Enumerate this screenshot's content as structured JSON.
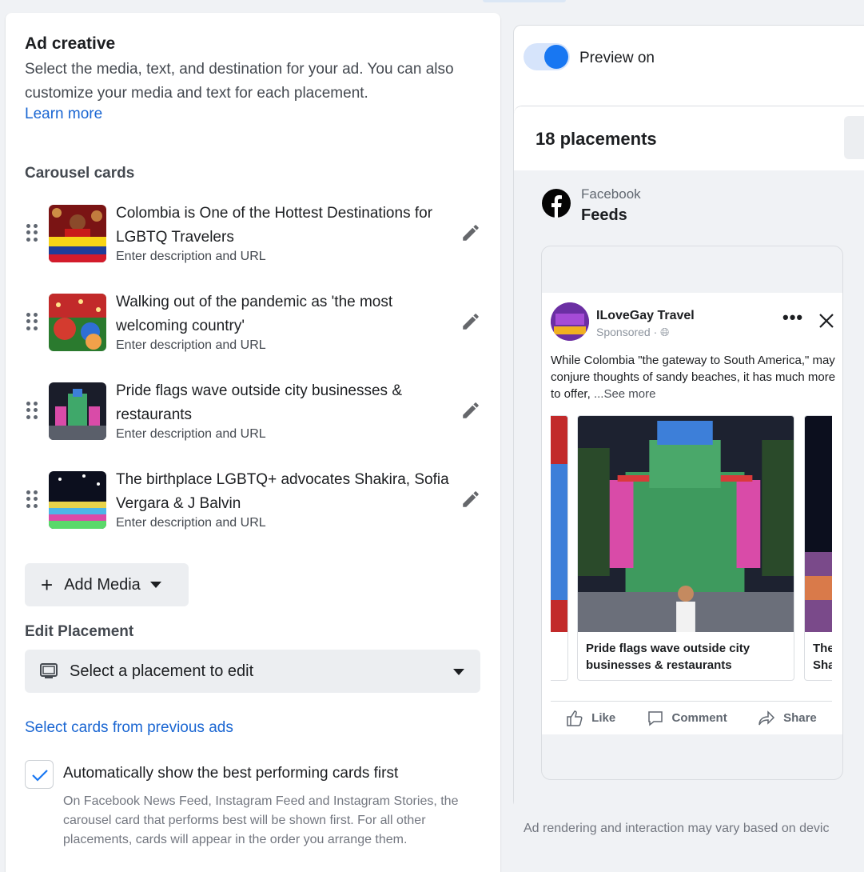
{
  "ad_creative": {
    "title": "Ad creative",
    "description": "Select the media, text, and destination for your ad. You can also customize your media and text for each placement.",
    "learn_more": "Learn more"
  },
  "carousel": {
    "heading": "Carousel cards",
    "cards": [
      {
        "title": "Colombia is One of the Hottest Destinations for LGBTQ Travelers",
        "subtitle": "Enter description and URL"
      },
      {
        "title": "Walking out of the pandemic as 'the most welcoming country'",
        "subtitle": "Enter description and URL"
      },
      {
        "title": "Pride flags wave outside city businesses & restaurants",
        "subtitle": "Enter description and URL"
      },
      {
        "title": "The birthplace LGBTQ+ advocates Shakira, Sofia Vergara & J Balvin",
        "subtitle": "Enter description and URL"
      }
    ],
    "add_media": "Add Media"
  },
  "edit_placement": {
    "heading": "Edit Placement",
    "select_value": "Select a placement to edit"
  },
  "previous_ads_link": "Select cards from previous ads",
  "auto_best": {
    "label": "Automatically show the best performing cards first",
    "help": "On Facebook News Feed, Instagram Feed and Instagram Stories, the carousel card that performs best will be shown first. For all other placements, cards will appear in the order you arrange them.",
    "checked": true
  },
  "preview": {
    "toggle_label": "Preview on",
    "toggle_on": true,
    "placements_count": "18 placements",
    "platform": "Facebook",
    "placement": "Feeds",
    "post": {
      "page_name": "ILoveGay Travel",
      "sponsored": "Sponsored · ",
      "text": "While Colombia \"the gateway to South America,\" may conjure thoughts of sandy beaches, it has much more to offer, ",
      "see_more": "...See more",
      "carousel_captions": [
        "Pride flags wave outside city businesses & restaurants",
        "The Sha"
      ],
      "actions": [
        "Like",
        "Comment",
        "Share"
      ]
    },
    "footnote": "Ad rendering and interaction may vary based on devic"
  },
  "colors": {
    "link": "#1a66d2",
    "toggle": "#1877f2",
    "panel_bg": "#f0f2f5"
  }
}
